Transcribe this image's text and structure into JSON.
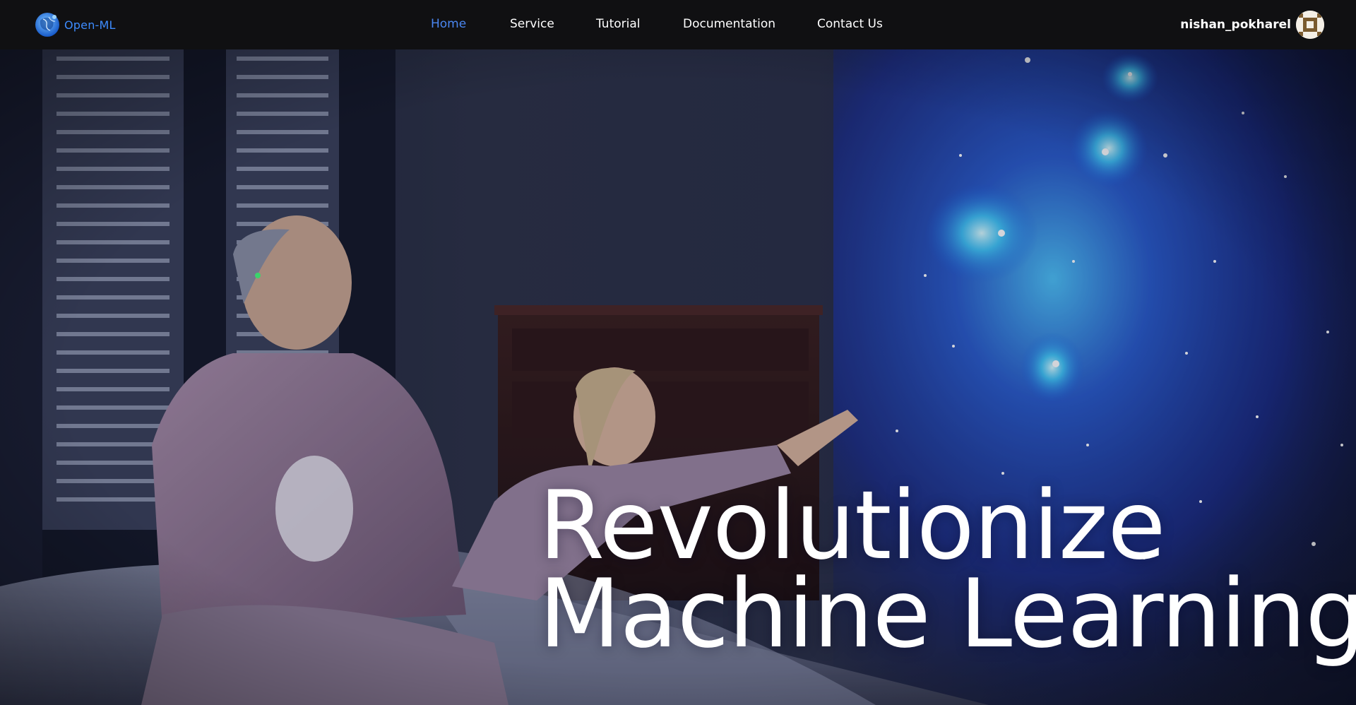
{
  "brand": {
    "name": "Open-ML",
    "logo_icon": "globe-brain-icon",
    "color": "#3d8bfd"
  },
  "nav": {
    "items": [
      {
        "label": "Home",
        "active": true
      },
      {
        "label": "Service",
        "active": false
      },
      {
        "label": "Tutorial",
        "active": false
      },
      {
        "label": "Documentation",
        "active": false
      },
      {
        "label": "Contact Us",
        "active": false
      }
    ],
    "active_color": "#4a86f0"
  },
  "user": {
    "name": "nishan_pokharel",
    "avatar_icon": "user-avatar-icon"
  },
  "hero": {
    "title_line1": "Revolutionize",
    "title_line2": "Machine Learning",
    "background": "hero-image"
  }
}
